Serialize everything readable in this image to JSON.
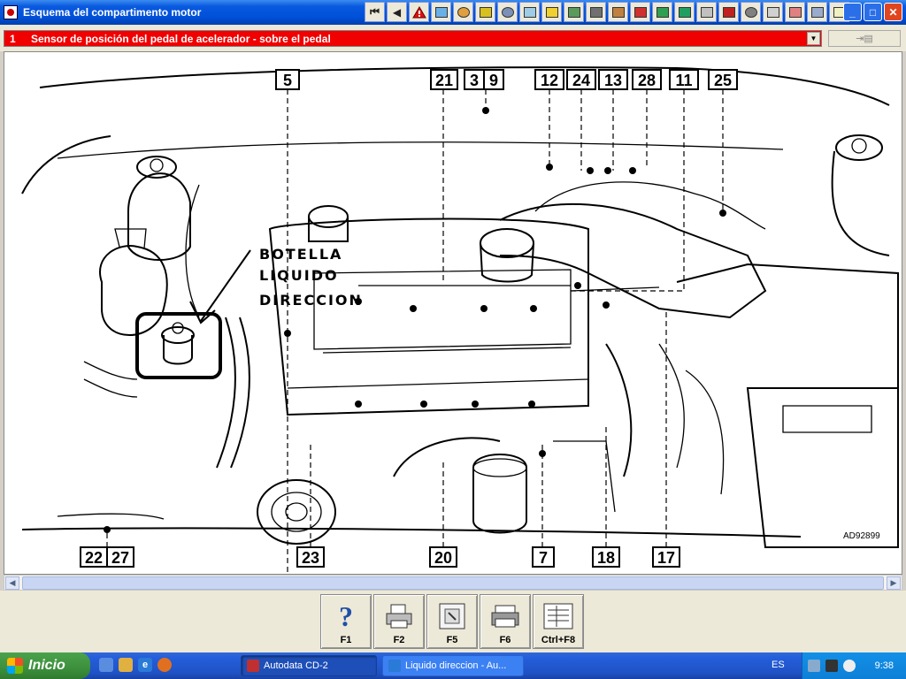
{
  "window": {
    "title": "Esquema del compartimento motor",
    "controls": {
      "minimize": "_",
      "maximize": "□",
      "close": "✕"
    }
  },
  "toolbar": {
    "first_icon": "first-record-icon",
    "prev_icon": "previous-record-icon",
    "first_glyph": "⏮",
    "prev_glyph": "◀",
    "items": [
      "warning-icon",
      "fuel-icon",
      "tuning-icon",
      "ignition-icon",
      "wheel-icon",
      "tool-icon",
      "battery-icon",
      "engine-icon",
      "calendar-icon",
      "belt-icon",
      "diagnostic-icon",
      "electrics-icon",
      "book-icon",
      "gauge-icon",
      "brakes-icon",
      "steering-icon",
      "repair-icon",
      "spark-icon",
      "car-icon",
      "note-icon"
    ]
  },
  "selector": {
    "number": "1",
    "label": "Sensor de posición del pedal de acelerador - sobre el pedal",
    "drop_glyph": "▼",
    "side_glyph": "⇥▤"
  },
  "diagram": {
    "callouts": {
      "c5": "5",
      "c21": "21",
      "c3": "3",
      "c9": "9",
      "c12": "12",
      "c24": "24",
      "c13": "13",
      "c28": "28",
      "c11": "11",
      "c25": "25",
      "c22": "22",
      "c27": "27",
      "c23": "23",
      "c20": "20",
      "c7": "7",
      "c18": "18",
      "c17": "17"
    },
    "annotation": [
      "BOTELLA",
      "LIQUIDO",
      "DIRECCION"
    ],
    "reference_code": "AD92899"
  },
  "scrollbar": {
    "left_glyph": "◀",
    "right_glyph": "▶"
  },
  "function_buttons": [
    {
      "label": "F1",
      "icon": "help-icon"
    },
    {
      "label": "F2",
      "icon": "printer-icon"
    },
    {
      "label": "F5",
      "icon": "document-icon"
    },
    {
      "label": "F6",
      "icon": "print-preview-icon"
    },
    {
      "label": "Ctrl+F8",
      "icon": "list-icon"
    }
  ],
  "taskbar": {
    "start_label": "Inicio",
    "tasks": [
      {
        "label": "Autodata CD-2",
        "active": true
      },
      {
        "label": "Liquido direccion - Au...",
        "active": false
      }
    ],
    "language": "ES",
    "time": "9:38"
  },
  "colors": {
    "selector_bg": "#f00000",
    "titlebar": "#0050d8",
    "taskbar": "#245edb",
    "start_button": "#3c8f3c"
  }
}
